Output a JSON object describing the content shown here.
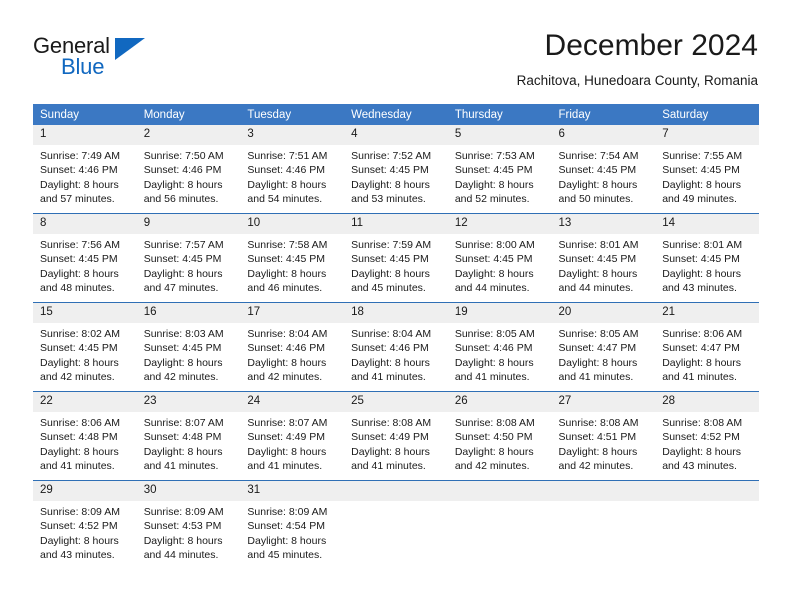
{
  "brand": {
    "word_one": "General",
    "word_two": "Blue",
    "triangle_icon": "brand-triangle-icon"
  },
  "header": {
    "month_title": "December 2024",
    "location": "Rachitova, Hunedoara County, Romania"
  },
  "theme": {
    "header_blue": "#3b78c3",
    "row_divider_blue": "#2f6fb5",
    "daynum_band": "#efefef",
    "brand_blue": "#1168c0",
    "text": "#1a1a1a"
  },
  "calendar": {
    "weekday_headers": [
      "Sunday",
      "Monday",
      "Tuesday",
      "Wednesday",
      "Thursday",
      "Friday",
      "Saturday"
    ],
    "labels": {
      "sunrise_prefix": "Sunrise: ",
      "sunset_prefix": "Sunset: ",
      "daylight_prefix": "Daylight: "
    },
    "weeks": [
      [
        {
          "day": "1",
          "sunrise": "Sunrise: 7:49 AM",
          "sunset": "Sunset: 4:46 PM",
          "daylight_line1": "Daylight: 8 hours",
          "daylight_line2": "and 57 minutes."
        },
        {
          "day": "2",
          "sunrise": "Sunrise: 7:50 AM",
          "sunset": "Sunset: 4:46 PM",
          "daylight_line1": "Daylight: 8 hours",
          "daylight_line2": "and 56 minutes."
        },
        {
          "day": "3",
          "sunrise": "Sunrise: 7:51 AM",
          "sunset": "Sunset: 4:46 PM",
          "daylight_line1": "Daylight: 8 hours",
          "daylight_line2": "and 54 minutes."
        },
        {
          "day": "4",
          "sunrise": "Sunrise: 7:52 AM",
          "sunset": "Sunset: 4:45 PM",
          "daylight_line1": "Daylight: 8 hours",
          "daylight_line2": "and 53 minutes."
        },
        {
          "day": "5",
          "sunrise": "Sunrise: 7:53 AM",
          "sunset": "Sunset: 4:45 PM",
          "daylight_line1": "Daylight: 8 hours",
          "daylight_line2": "and 52 minutes."
        },
        {
          "day": "6",
          "sunrise": "Sunrise: 7:54 AM",
          "sunset": "Sunset: 4:45 PM",
          "daylight_line1": "Daylight: 8 hours",
          "daylight_line2": "and 50 minutes."
        },
        {
          "day": "7",
          "sunrise": "Sunrise: 7:55 AM",
          "sunset": "Sunset: 4:45 PM",
          "daylight_line1": "Daylight: 8 hours",
          "daylight_line2": "and 49 minutes."
        }
      ],
      [
        {
          "day": "8",
          "sunrise": "Sunrise: 7:56 AM",
          "sunset": "Sunset: 4:45 PM",
          "daylight_line1": "Daylight: 8 hours",
          "daylight_line2": "and 48 minutes."
        },
        {
          "day": "9",
          "sunrise": "Sunrise: 7:57 AM",
          "sunset": "Sunset: 4:45 PM",
          "daylight_line1": "Daylight: 8 hours",
          "daylight_line2": "and 47 minutes."
        },
        {
          "day": "10",
          "sunrise": "Sunrise: 7:58 AM",
          "sunset": "Sunset: 4:45 PM",
          "daylight_line1": "Daylight: 8 hours",
          "daylight_line2": "and 46 minutes."
        },
        {
          "day": "11",
          "sunrise": "Sunrise: 7:59 AM",
          "sunset": "Sunset: 4:45 PM",
          "daylight_line1": "Daylight: 8 hours",
          "daylight_line2": "and 45 minutes."
        },
        {
          "day": "12",
          "sunrise": "Sunrise: 8:00 AM",
          "sunset": "Sunset: 4:45 PM",
          "daylight_line1": "Daylight: 8 hours",
          "daylight_line2": "and 44 minutes."
        },
        {
          "day": "13",
          "sunrise": "Sunrise: 8:01 AM",
          "sunset": "Sunset: 4:45 PM",
          "daylight_line1": "Daylight: 8 hours",
          "daylight_line2": "and 44 minutes."
        },
        {
          "day": "14",
          "sunrise": "Sunrise: 8:01 AM",
          "sunset": "Sunset: 4:45 PM",
          "daylight_line1": "Daylight: 8 hours",
          "daylight_line2": "and 43 minutes."
        }
      ],
      [
        {
          "day": "15",
          "sunrise": "Sunrise: 8:02 AM",
          "sunset": "Sunset: 4:45 PM",
          "daylight_line1": "Daylight: 8 hours",
          "daylight_line2": "and 42 minutes."
        },
        {
          "day": "16",
          "sunrise": "Sunrise: 8:03 AM",
          "sunset": "Sunset: 4:45 PM",
          "daylight_line1": "Daylight: 8 hours",
          "daylight_line2": "and 42 minutes."
        },
        {
          "day": "17",
          "sunrise": "Sunrise: 8:04 AM",
          "sunset": "Sunset: 4:46 PM",
          "daylight_line1": "Daylight: 8 hours",
          "daylight_line2": "and 42 minutes."
        },
        {
          "day": "18",
          "sunrise": "Sunrise: 8:04 AM",
          "sunset": "Sunset: 4:46 PM",
          "daylight_line1": "Daylight: 8 hours",
          "daylight_line2": "and 41 minutes."
        },
        {
          "day": "19",
          "sunrise": "Sunrise: 8:05 AM",
          "sunset": "Sunset: 4:46 PM",
          "daylight_line1": "Daylight: 8 hours",
          "daylight_line2": "and 41 minutes."
        },
        {
          "day": "20",
          "sunrise": "Sunrise: 8:05 AM",
          "sunset": "Sunset: 4:47 PM",
          "daylight_line1": "Daylight: 8 hours",
          "daylight_line2": "and 41 minutes."
        },
        {
          "day": "21",
          "sunrise": "Sunrise: 8:06 AM",
          "sunset": "Sunset: 4:47 PM",
          "daylight_line1": "Daylight: 8 hours",
          "daylight_line2": "and 41 minutes."
        }
      ],
      [
        {
          "day": "22",
          "sunrise": "Sunrise: 8:06 AM",
          "sunset": "Sunset: 4:48 PM",
          "daylight_line1": "Daylight: 8 hours",
          "daylight_line2": "and 41 minutes."
        },
        {
          "day": "23",
          "sunrise": "Sunrise: 8:07 AM",
          "sunset": "Sunset: 4:48 PM",
          "daylight_line1": "Daylight: 8 hours",
          "daylight_line2": "and 41 minutes."
        },
        {
          "day": "24",
          "sunrise": "Sunrise: 8:07 AM",
          "sunset": "Sunset: 4:49 PM",
          "daylight_line1": "Daylight: 8 hours",
          "daylight_line2": "and 41 minutes."
        },
        {
          "day": "25",
          "sunrise": "Sunrise: 8:08 AM",
          "sunset": "Sunset: 4:49 PM",
          "daylight_line1": "Daylight: 8 hours",
          "daylight_line2": "and 41 minutes."
        },
        {
          "day": "26",
          "sunrise": "Sunrise: 8:08 AM",
          "sunset": "Sunset: 4:50 PM",
          "daylight_line1": "Daylight: 8 hours",
          "daylight_line2": "and 42 minutes."
        },
        {
          "day": "27",
          "sunrise": "Sunrise: 8:08 AM",
          "sunset": "Sunset: 4:51 PM",
          "daylight_line1": "Daylight: 8 hours",
          "daylight_line2": "and 42 minutes."
        },
        {
          "day": "28",
          "sunrise": "Sunrise: 8:08 AM",
          "sunset": "Sunset: 4:52 PM",
          "daylight_line1": "Daylight: 8 hours",
          "daylight_line2": "and 43 minutes."
        }
      ],
      [
        {
          "day": "29",
          "sunrise": "Sunrise: 8:09 AM",
          "sunset": "Sunset: 4:52 PM",
          "daylight_line1": "Daylight: 8 hours",
          "daylight_line2": "and 43 minutes."
        },
        {
          "day": "30",
          "sunrise": "Sunrise: 8:09 AM",
          "sunset": "Sunset: 4:53 PM",
          "daylight_line1": "Daylight: 8 hours",
          "daylight_line2": "and 44 minutes."
        },
        {
          "day": "31",
          "sunrise": "Sunrise: 8:09 AM",
          "sunset": "Sunset: 4:54 PM",
          "daylight_line1": "Daylight: 8 hours",
          "daylight_line2": "and 45 minutes."
        },
        {
          "day": "",
          "sunrise": "",
          "sunset": "",
          "daylight_line1": "",
          "daylight_line2": ""
        },
        {
          "day": "",
          "sunrise": "",
          "sunset": "",
          "daylight_line1": "",
          "daylight_line2": ""
        },
        {
          "day": "",
          "sunrise": "",
          "sunset": "",
          "daylight_line1": "",
          "daylight_line2": ""
        },
        {
          "day": "",
          "sunrise": "",
          "sunset": "",
          "daylight_line1": "",
          "daylight_line2": ""
        }
      ]
    ]
  }
}
